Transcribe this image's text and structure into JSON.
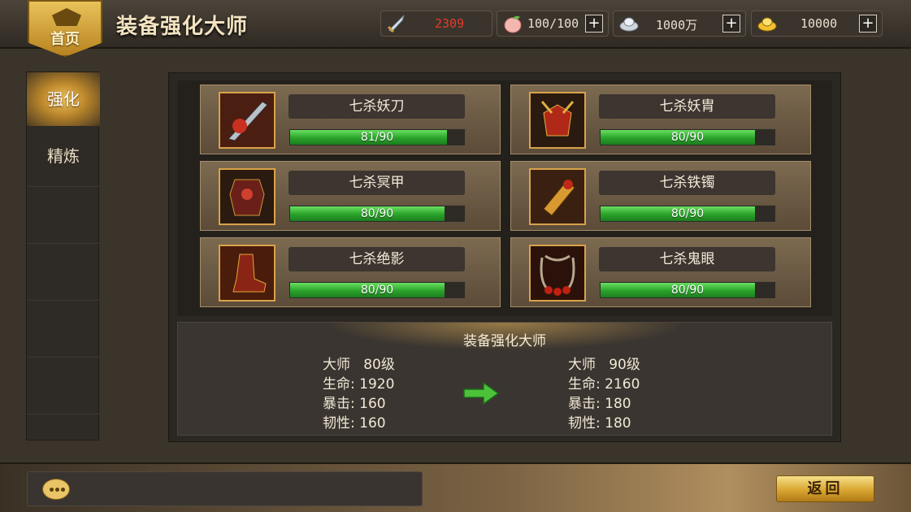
{
  "header": {
    "home_label": "首页",
    "title": "装备强化大师"
  },
  "resources": [
    {
      "name": "combat-power",
      "icon": "sword-icon",
      "value": "2309",
      "color": "#e83a2a",
      "has_plus": false
    },
    {
      "name": "stamina",
      "icon": "peach-icon",
      "value": "100/100",
      "color": "#e8e0d0",
      "has_plus": true
    },
    {
      "name": "silver",
      "icon": "silver-ingot-icon",
      "value": "1000万",
      "color": "#e8e0d0",
      "has_plus": true
    },
    {
      "name": "gold",
      "icon": "gold-ingot-icon",
      "value": "10000",
      "color": "#e8e0d0",
      "has_plus": true
    }
  ],
  "sidebar": {
    "tabs": [
      {
        "label": "强化",
        "active": true
      },
      {
        "label": "精炼",
        "active": false
      }
    ]
  },
  "equipment": [
    {
      "name": "七杀妖刀",
      "icon": "saber-icon",
      "level": 81,
      "max": 90,
      "progress_text": "81/90"
    },
    {
      "name": "七杀妖胄",
      "icon": "helmet-icon",
      "level": 80,
      "max": 90,
      "progress_text": "80/90"
    },
    {
      "name": "七杀冥甲",
      "icon": "armor-icon",
      "level": 80,
      "max": 90,
      "progress_text": "80/90"
    },
    {
      "name": "七杀铁镯",
      "icon": "bracer-icon",
      "level": 80,
      "max": 90,
      "progress_text": "80/90"
    },
    {
      "name": "七杀绝影",
      "icon": "boots-icon",
      "level": 80,
      "max": 90,
      "progress_text": "80/90"
    },
    {
      "name": "七杀鬼眼",
      "icon": "necklace-icon",
      "level": 80,
      "max": 90,
      "progress_text": "80/90"
    }
  ],
  "master": {
    "title": "装备强化大师",
    "current": {
      "level_line": "大师   80级",
      "hp_line": "生命: 1920",
      "crit_line": "暴击: 160",
      "tough_line": "韧性: 160"
    },
    "next": {
      "level_line": "大师   90级",
      "hp_line": "生命: 2160",
      "crit_line": "暴击: 180",
      "tough_line": "韧性: 180"
    }
  },
  "footer": {
    "chat_icon": "chat-bubble-icon",
    "back_label": "返回"
  }
}
